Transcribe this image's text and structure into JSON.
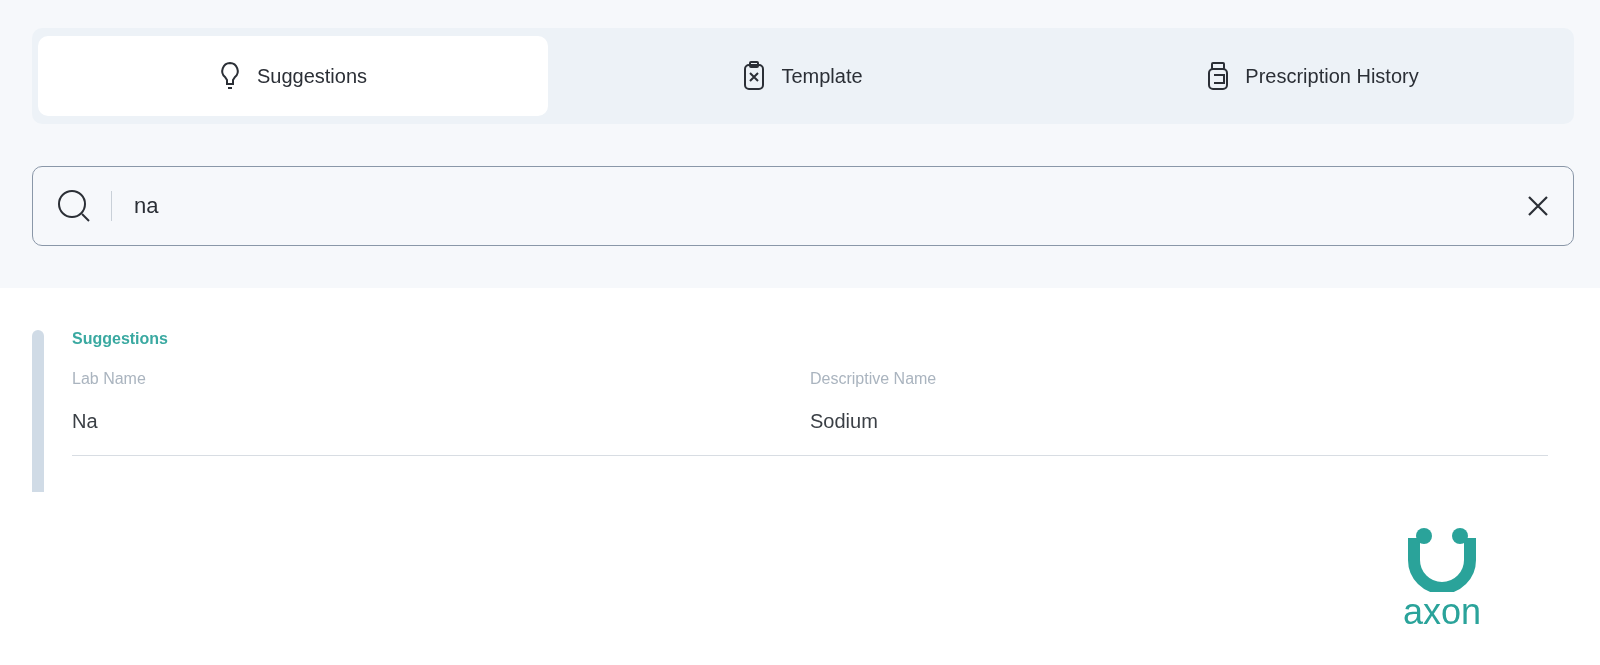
{
  "tabs": [
    {
      "label": "Suggestions",
      "selected": true
    },
    {
      "label": "Template",
      "selected": false
    },
    {
      "label": "Prescription History",
      "selected": false
    }
  ],
  "search": {
    "value": "na"
  },
  "results": {
    "heading": "Suggestions",
    "columns": [
      "Lab Name",
      "Descriptive Name"
    ],
    "rows": [
      {
        "cells": [
          "Na",
          "Sodium"
        ]
      }
    ]
  },
  "logo": {
    "text": "axon"
  }
}
